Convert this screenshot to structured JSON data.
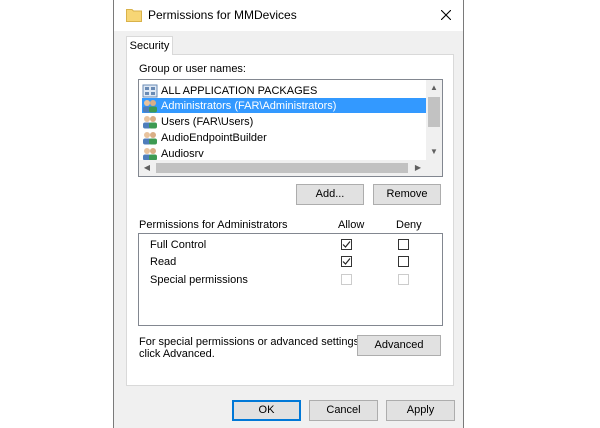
{
  "window": {
    "title": "Permissions for MMDevices",
    "folder_icon_color": "#f7d675"
  },
  "tabs": [
    {
      "label": "Security",
      "selected": true
    }
  ],
  "group_section": {
    "label": "Group or user names:",
    "items": [
      {
        "label": "ALL APPLICATION PACKAGES",
        "icon": "packages-icon",
        "selected": false
      },
      {
        "label": "Administrators (FAR\\Administrators)",
        "icon": "users-group-icon",
        "selected": true
      },
      {
        "label": "Users (FAR\\Users)",
        "icon": "users-group-icon",
        "selected": false
      },
      {
        "label": "AudioEndpointBuilder",
        "icon": "users-group-icon",
        "selected": false
      },
      {
        "label": "Audiosrv",
        "icon": "users-group-icon",
        "selected": false
      }
    ],
    "add_label": "Add...",
    "remove_label": "Remove"
  },
  "permissions": {
    "header": "Permissions for Administrators",
    "allow_header": "Allow",
    "deny_header": "Deny",
    "rows": [
      {
        "label": "Full Control",
        "allow": true,
        "deny": false,
        "enabled": true
      },
      {
        "label": "Read",
        "allow": true,
        "deny": false,
        "enabled": true
      },
      {
        "label": "Special permissions",
        "allow": false,
        "deny": false,
        "enabled": false
      }
    ]
  },
  "advanced": {
    "text_line1": "For special permissions or advanced settings,",
    "text_line2": "click Advanced.",
    "button_label": "Advanced"
  },
  "footer": {
    "ok_label": "OK",
    "cancel_label": "Cancel",
    "apply_label": "Apply"
  },
  "colors": {
    "selection": "#3399ff",
    "default_button_border": "#0078d7"
  }
}
